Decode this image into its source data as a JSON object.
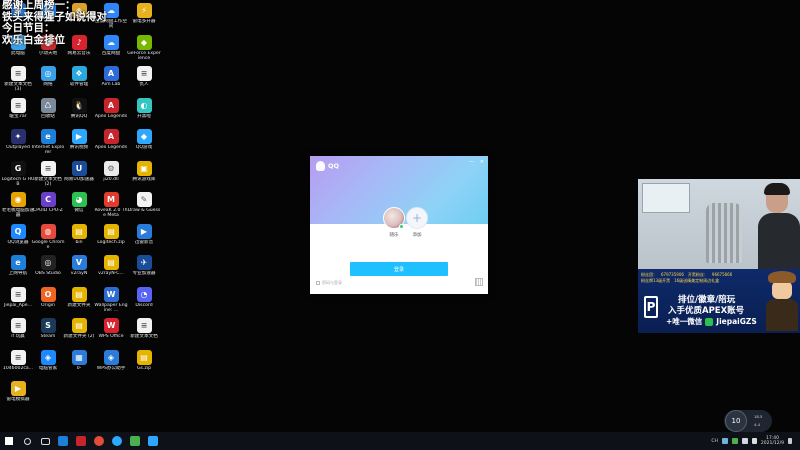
{
  "overlay": {
    "lines": [
      "感谢上周榜一：",
      "铁头来得猩子如说得对",
      "今日节目：",
      "欢乐白金排位"
    ]
  },
  "desktop_icons": [
    {
      "label": "",
      "color": "#2b7bd8",
      "glyph": "◉"
    },
    {
      "label": "",
      "color": "#1e90ff",
      "glyph": "▶"
    },
    {
      "label": "",
      "color": "#d9a12a",
      "glyph": "◈"
    },
    {
      "label": "百度网盘工作空间",
      "color": "#2f86f6",
      "glyph": "☁"
    },
    {
      "label": "雷电多开器",
      "color": "#e8b21f",
      "glyph": "⚡"
    },
    {
      "label": "此电脑",
      "color": "#3aa0e6",
      "glyph": "▭"
    },
    {
      "label": "小动天地",
      "color": "#c62a2a",
      "glyph": "●"
    },
    {
      "label": "网易云音乐",
      "color": "#d6242f",
      "glyph": "♪"
    },
    {
      "label": "百度网盘",
      "color": "#2f86f6",
      "glyph": "☁"
    },
    {
      "label": "GeForce Experience",
      "color": "#76b900",
      "glyph": "◆"
    },
    {
      "label": "新建文本文档 (3)",
      "color": "#f2f2f2",
      "glyph": "≡"
    },
    {
      "label": "网络",
      "color": "#3aa0e6",
      "glyph": "◎"
    },
    {
      "label": "软件管理",
      "color": "#2aa8e0",
      "glyph": "❖"
    },
    {
      "label": "Aim Lab",
      "color": "#2b6cd8",
      "glyph": "A"
    },
    {
      "label": "仇人",
      "color": "#f2f2f2",
      "glyph": "≡"
    },
    {
      "label": "暖宝.rar",
      "color": "#f2f2f2",
      "glyph": "≡"
    },
    {
      "label": "回收站",
      "color": "#7a8a99",
      "glyph": "♺"
    },
    {
      "label": "腾讯QQ",
      "color": "#111111",
      "glyph": "🐧"
    },
    {
      "label": "Apex Legends",
      "color": "#c8242b",
      "glyph": "A"
    },
    {
      "label": "开黑啦",
      "color": "#36c6c2",
      "glyph": "◐"
    },
    {
      "label": "Outplayed",
      "color": "#2a2f6e",
      "glyph": "✦"
    },
    {
      "label": "Internet Explorer",
      "color": "#1e7fd9",
      "glyph": "e"
    },
    {
      "label": "腾讯视频",
      "color": "#2ea7ff",
      "glyph": "▶"
    },
    {
      "label": "Apex Legends",
      "color": "#c8242b",
      "glyph": "A"
    },
    {
      "label": "QQ游戏",
      "color": "#2ea7ff",
      "glyph": "◆"
    },
    {
      "label": "Logitech G HUB",
      "color": "#111111",
      "glyph": "G"
    },
    {
      "label": "新建文本文档 (2)",
      "color": "#f2f2f2",
      "glyph": "≡"
    },
    {
      "label": "网易UU加速器",
      "color": "#1a4c9a",
      "glyph": "U"
    },
    {
      "label": "ji20.dll",
      "color": "#eaeaea",
      "glyph": "⚙"
    },
    {
      "label": "腾讯游戏库",
      "color": "#e5b400",
      "glyph": "▣"
    },
    {
      "label": "老毛桃电脑加速器",
      "color": "#e5a300",
      "glyph": "◉"
    },
    {
      "label": "CPUID CPU-Z",
      "color": "#6a3fc9",
      "glyph": "C"
    },
    {
      "label": "微信",
      "color": "#2bc24f",
      "glyph": "◕"
    },
    {
      "label": "RoveaK 2.0 The Meta",
      "color": "#e23b2c",
      "glyph": "M"
    },
    {
      "label": "Draw & Guess",
      "color": "#f2f2f2",
      "glyph": "✎"
    },
    {
      "label": "QQ浏览器",
      "color": "#1e88ff",
      "glyph": "Q"
    },
    {
      "label": "Google Chrome",
      "color": "#e64a3b",
      "glyph": "◍"
    },
    {
      "label": "bin",
      "color": "#e5b400",
      "glyph": "▤"
    },
    {
      "label": "Logitech.zip",
      "color": "#e5b400",
      "glyph": "▤"
    },
    {
      "label": "迅雷影音",
      "color": "#2b7bd8",
      "glyph": "▶"
    },
    {
      "label": "上网导航",
      "color": "#1e7fd9",
      "glyph": "e"
    },
    {
      "label": "OBS Studio",
      "color": "#222222",
      "glyph": "◎"
    },
    {
      "label": "v2rayN",
      "color": "#2b7bd8",
      "glyph": "V"
    },
    {
      "label": "v2rayN-C...",
      "color": "#e5b400",
      "glyph": "▤"
    },
    {
      "label": "专业加速器",
      "color": "#1a4c9a",
      "glyph": "✈"
    },
    {
      "label": "Jiepai_Ape...",
      "color": "#f2f2f2",
      "glyph": "≡"
    },
    {
      "label": "Origin",
      "color": "#f06424",
      "glyph": "O"
    },
    {
      "label": "新建文件夹",
      "color": "#e5b400",
      "glyph": "▤"
    },
    {
      "label": "Wallpaper Engine: ...",
      "color": "#2d6ccf",
      "glyph": "W"
    },
    {
      "label": "Discord",
      "color": "#5865f2",
      "glyph": "◔"
    },
    {
      "label": "if 玩赢",
      "color": "#f2f2f2",
      "glyph": "≡"
    },
    {
      "label": "Steam",
      "color": "#1b3a5a",
      "glyph": "S"
    },
    {
      "label": "新建文件夹 (2)",
      "color": "#e5b400",
      "glyph": "▤"
    },
    {
      "label": "WPS Office",
      "color": "#d6242f",
      "glyph": "W"
    },
    {
      "label": "新建文本文档",
      "color": "#f2f2f2",
      "glyph": "≡"
    },
    {
      "label": "1046002ca...",
      "color": "#f2f2f2",
      "glyph": "≡"
    },
    {
      "label": "电脑管家",
      "color": "#1e88ff",
      "glyph": "◈"
    },
    {
      "label": "0-",
      "color": "#2b7bd8",
      "glyph": "▦"
    },
    {
      "label": "WPS办公助手",
      "color": "#2b7bd8",
      "glyph": "◈"
    },
    {
      "label": "Gs.zip",
      "color": "#e5b400",
      "glyph": "▤"
    },
    {
      "label": "雷电模拟器",
      "color": "#e8b21f",
      "glyph": "▶"
    }
  ],
  "qq_window": {
    "app_name": "QQ",
    "account1_name": "随乐",
    "account2_name": "添加",
    "login_label": "登录",
    "remember_label": "密码与登录",
    "minimize_icon": "—",
    "close_icon": "✕"
  },
  "ad_panel": {
    "top_items": [
      "粉丝团：",
      "679735906",
      "开黑粉丝：",
      "96675666",
      "粉丝牌13级开黑",
      "16级送精美定制周边礼盒"
    ],
    "line1": "排位/徽章/陪玩",
    "line2": "入手优质APEX账号",
    "line3_prefix": "+唯一微信",
    "wechat_id": "JiepaiGZS",
    "logo_letter": "P"
  },
  "volume_osd": {
    "level": "10",
    "row1": "18.5",
    "row2": "4.4"
  },
  "taskbar": {
    "icons": [
      "windows-start",
      "search",
      "task-view",
      "edge",
      "app-red",
      "chrome",
      "qq",
      "game",
      "app-blue"
    ],
    "tray_lang": "CH",
    "time": "17:40",
    "date": "2021/12/9"
  }
}
